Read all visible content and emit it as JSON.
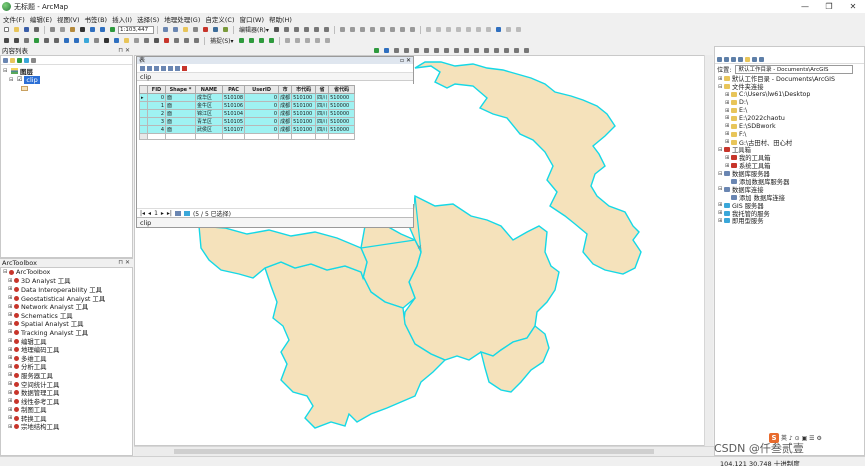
{
  "window": {
    "title": "无标题 - ArcMap",
    "controls": [
      "—",
      "❐",
      "✕"
    ]
  },
  "menu": [
    "文件(F)",
    "编辑(E)",
    "视图(V)",
    "书签(B)",
    "插入(I)",
    "选择(S)",
    "地理处理(G)",
    "自定义(C)",
    "窗口(W)",
    "帮助(H)"
  ],
  "toolbar": {
    "scale": "1:103,447",
    "edit_label": "编辑器(R)▾",
    "snap_label": "捕捉(S)▾"
  },
  "toc": {
    "title": "内容列表",
    "root": "图层",
    "layer": "clip"
  },
  "attribute_table": {
    "window_title": "表",
    "table_name": "clip",
    "columns": [
      "FID",
      "Shape *",
      "NAME",
      "PAC",
      "UserID",
      "市",
      "市代码",
      "省",
      "省代码"
    ],
    "rows": [
      [
        "0",
        "面",
        "成华区",
        "510108",
        "0",
        "成都",
        "510100",
        "四川",
        "510000"
      ],
      [
        "1",
        "面",
        "金牛区",
        "510106",
        "0",
        "成都",
        "510100",
        "四川",
        "510000"
      ],
      [
        "2",
        "面",
        "锦江区",
        "510104",
        "0",
        "成都",
        "510100",
        "四川",
        "510000"
      ],
      [
        "3",
        "面",
        "青羊区",
        "510105",
        "0",
        "成都",
        "510100",
        "四川",
        "510000"
      ],
      [
        "4",
        "面",
        "武侯区",
        "510107",
        "0",
        "成都",
        "510100",
        "四川",
        "510000"
      ]
    ],
    "page_index": "1",
    "selection_status": "(5 / 5 已选择)",
    "bottom_tab": "clip"
  },
  "toolbox": {
    "title": "ArcToolbox",
    "root": "ArcToolbox",
    "items": [
      "3D Analyst 工具",
      "Data Interoperability 工具",
      "Geostatistical Analyst 工具",
      "Network Analyst 工具",
      "Schematics 工具",
      "Spatial Analyst 工具",
      "Tracking Analyst 工具",
      "编辑工具",
      "地理编码工具",
      "多维工具",
      "分析工具",
      "服务器工具",
      "空间统计工具",
      "数据管理工具",
      "线性参考工具",
      "制图工具",
      "转换工具",
      "宗地结构工具"
    ]
  },
  "catalog": {
    "title": "目录",
    "location_label": "位置:",
    "location_value": "默认工作目录 - Documents\\ArcGIS",
    "items": [
      {
        "label": "默认工作目录 - Documents\\ArcGIS",
        "indent": 0,
        "sign": "⊞"
      },
      {
        "label": "文件夹连接",
        "indent": 0,
        "sign": "⊟"
      },
      {
        "label": "C:\\Users\\lw61\\Desktop",
        "indent": 1,
        "sign": "⊞"
      },
      {
        "label": "D:\\",
        "indent": 1,
        "sign": "⊞"
      },
      {
        "label": "E:\\",
        "indent": 1,
        "sign": "⊞"
      },
      {
        "label": "E:\\2022chaotu",
        "indent": 1,
        "sign": "⊞"
      },
      {
        "label": "E:\\SDBwork",
        "indent": 1,
        "sign": "⊞"
      },
      {
        "label": "F:\\",
        "indent": 1,
        "sign": "⊞"
      },
      {
        "label": "G:\\古田村、田心村",
        "indent": 1,
        "sign": "⊞"
      },
      {
        "label": "工具箱",
        "indent": 0,
        "sign": "⊟"
      },
      {
        "label": "我的工具箱",
        "indent": 1,
        "sign": "⊞"
      },
      {
        "label": "系统工具箱",
        "indent": 1,
        "sign": "⊞"
      },
      {
        "label": "数据库服务器",
        "indent": 0,
        "sign": "⊟"
      },
      {
        "label": "添加数据库服务器",
        "indent": 1,
        "sign": ""
      },
      {
        "label": "数据库连接",
        "indent": 0,
        "sign": "⊟"
      },
      {
        "label": "添加 数据库连接",
        "indent": 1,
        "sign": ""
      },
      {
        "label": "GIS 服务器",
        "indent": 0,
        "sign": "⊞"
      },
      {
        "label": "我托管的服务",
        "indent": 0,
        "sign": "⊞"
      },
      {
        "label": "即用型服务",
        "indent": 0,
        "sign": "⊞"
      }
    ]
  },
  "status": {
    "coords": "104.121  30.748 十进制度"
  },
  "watermark": "CSDN @仟叁贰壹",
  "colors": {
    "polygon_fill": "#f5e2bb",
    "polygon_stroke": "#15d8e6",
    "selected_row": "#9ff2f2",
    "toc_selected": "#2b6fd6"
  }
}
